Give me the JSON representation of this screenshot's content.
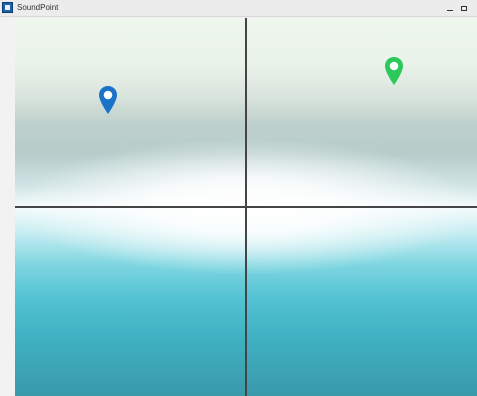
{
  "window": {
    "title": "SoundPoint",
    "minimize_label": "–",
    "maximize_label": "□"
  },
  "map": {
    "grid": "2x2",
    "markers": [
      {
        "name": "blue-location-marker",
        "color": "#1b73c9"
      },
      {
        "name": "green-location-marker",
        "color": "#2bc95a"
      }
    ]
  },
  "colors": {
    "titlebar": "#ececec",
    "grid_line": "#454545",
    "canvas_top": "#eef6ee",
    "canvas_bottom": "#3a9aaa"
  }
}
